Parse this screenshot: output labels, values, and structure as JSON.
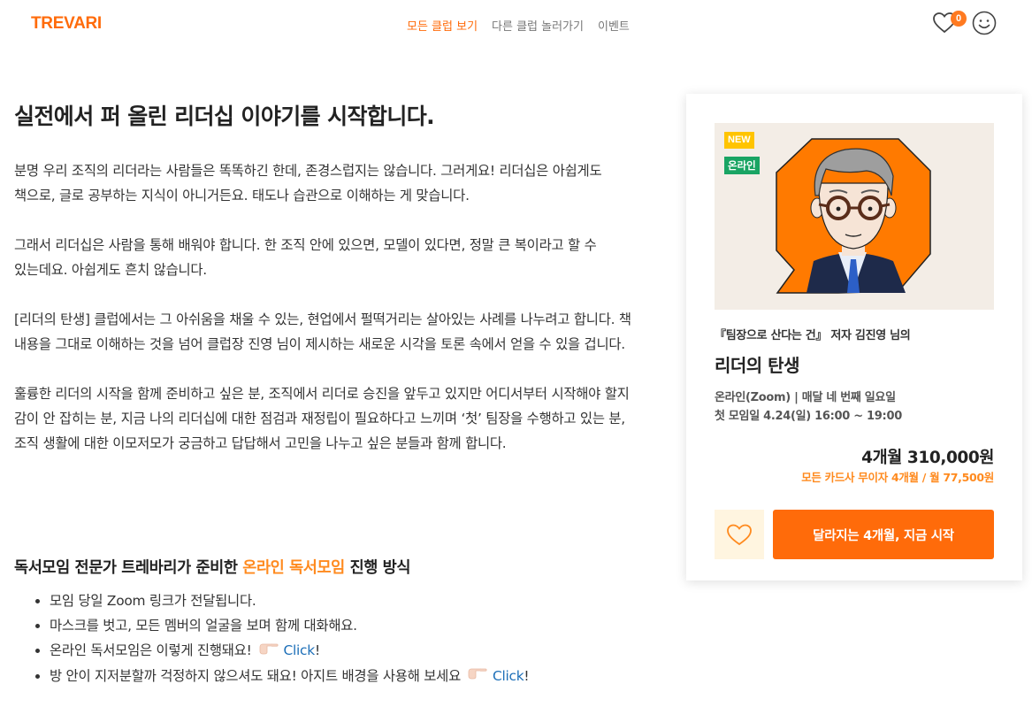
{
  "header": {
    "logo": "TREVARI",
    "nav": [
      "모든 클럽 보기",
      "다른 클럽 놀러가기",
      "이벤트"
    ],
    "active_nav": "모든 클럽 보기",
    "wishlist_count": "0",
    "icons": [
      "heart-icon",
      "smiley-profile-icon"
    ]
  },
  "article": {
    "title": "실전에서 퍼 올린 리더십 이야기를 시작합니다.",
    "paragraphs": [
      "분명 우리 조직의 리더라는 사람들은 똑똑하긴 한데, 존경스럽지는 않습니다. 그러게요! 리더십은 아쉽게도 책으로, 글로 공부하는 지식이 아니거든요. 태도나 습관으로 이해하는 게 맞습니다.",
      "그래서 리더십은 사람을 통해 배워야 합니다. 한 조직 안에 있으면, 모델이 있다면, 정말 큰 복이라고 할 수 있는데요. 아쉽게도 흔치 않습니다.",
      "[리더의 탄생] 클럽에서는 그 아쉬움을 채울 수 있는, 현업에서 펄떡거리는 살아있는 사례를 나누려고 합니다. 책 내용을 그대로 이해하는 것을 넘어 클럽장 진영 님이 제시하는 새로운 시각을 토론 속에서 얻을 수 있을 겁니다.",
      "훌륭한 리더의 시작을 함께 준비하고 싶은 분, 조직에서 리더로 승진을 앞두고 있지만 어디서부터 시작해야 할지 감이 안 잡히는 분, 지금 나의 리더십에 대한 점검과 재정립이 필요하다고 느끼며 ‘첫’ 팀장을 수행하고 있는 분, 조직 생활에 대한 이모저모가 궁금하고 답답해서 고민을 나누고 싶은 분들과 함께 합니다."
    ],
    "section": {
      "title_prefix": "독서모임 전문가 트레바리가 준비한 ",
      "title_highlight": "온라인 독서모임",
      "title_suffix": " 진행 방식",
      "bullets": [
        {
          "text": "모임 당일 Zoom 링크가 전달됩니다."
        },
        {
          "text": "마스크를 벗고, 모든 멤버의 얼굴을 보며 함께 대화해요."
        },
        {
          "text": "온라인 독서모임은 이렇게 진행돼요!",
          "link": "Click",
          "after": "!"
        },
        {
          "text": "방 안이 지저분할까 걱정하지 않으셔도 돼요! 아지트 배경을 사용해 보세요",
          "link": "Click",
          "after": "!"
        }
      ]
    }
  },
  "card": {
    "badge_new": "NEW",
    "badge_online": "온라인",
    "subtitle": "『팀장으로 산다는 건』 저자 김진영 님의",
    "title": "리더의 탄생",
    "meta_line1": "온라인(Zoom) | 매달 네 번째 일요일",
    "meta_line2": "첫 모임일 4.24(일) 16:00 ~ 19:00",
    "price": "4개월 310,000원",
    "installment": "모든 카드사 무이자 4개월 / 월 77,500원",
    "cta": "달라지는 4개월, 지금 시작",
    "colors": {
      "accent": "#ff6b0a",
      "highlight": "#ff8a1e",
      "new_badge": "#ffc400",
      "online_badge": "#19a463"
    }
  }
}
